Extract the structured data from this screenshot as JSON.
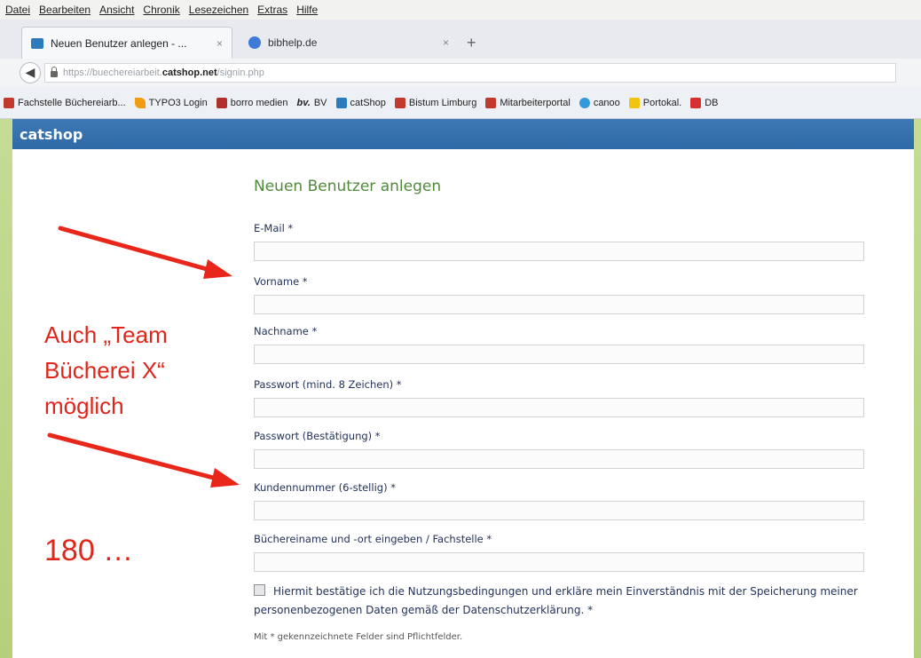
{
  "menu": [
    "Datei",
    "Bearbeiten",
    "Ansicht",
    "Chronik",
    "Lesezeichen",
    "Extras",
    "Hilfe"
  ],
  "tabs": [
    {
      "label": "Neuen Benutzer anlegen - ...",
      "close": "×"
    },
    {
      "label": "bibhelp.de",
      "close": "×"
    }
  ],
  "new_tab": "+",
  "url": {
    "prefix": "https://buechereiarbeit.",
    "domain": "catshop.net",
    "path": "/signin.php"
  },
  "bookmarks": [
    {
      "label": "Fachstelle Büchereiarb...",
      "icon": "ah-icon"
    },
    {
      "label": "TYPO3 Login",
      "icon": "typo3-icon"
    },
    {
      "label": "borro medien",
      "icon": "borro-icon"
    },
    {
      "label": "BV",
      "icon": "bv-icon",
      "icon_text": "bv."
    },
    {
      "label": "catShop",
      "icon": "catshop-icon"
    },
    {
      "label": "Bistum Limburg",
      "icon": "ah-icon"
    },
    {
      "label": "Mitarbeiterportal",
      "icon": "ah-icon"
    },
    {
      "label": "canoo",
      "icon": "canoo-icon"
    },
    {
      "label": "Portokal.",
      "icon": "post-icon"
    },
    {
      "label": "DB",
      "icon": "db-icon"
    }
  ],
  "app": {
    "brand": "catshop"
  },
  "form": {
    "title": "Neuen Benutzer anlegen",
    "fields": [
      {
        "label": "E-Mail *",
        "value": ""
      },
      {
        "label": "Vorname *",
        "value": ""
      },
      {
        "label": "Nachname *",
        "value": ""
      },
      {
        "label": "Passwort (mind. 8 Zeichen) *",
        "value": ""
      },
      {
        "label": "Passwort (Bestätigung) *",
        "value": ""
      },
      {
        "label": "Kundennummer (6-stellig) *",
        "value": ""
      },
      {
        "label": "Büchereiname und -ort eingeben / Fachstelle *",
        "value": ""
      }
    ],
    "consent": "Hiermit bestätige ich die Nutzungsbedingungen und erkläre mein Einverständnis mit der Speicherung meiner personenbezogenen Daten gemäß der Datenschutzerklärung. *",
    "required_note": "Mit * gekennzeichnete Felder sind Pflichtfelder."
  },
  "annotations": {
    "note": "Auch „Team Bücherei X“ möglich",
    "number": "180 …",
    "color": "#e0261a"
  }
}
